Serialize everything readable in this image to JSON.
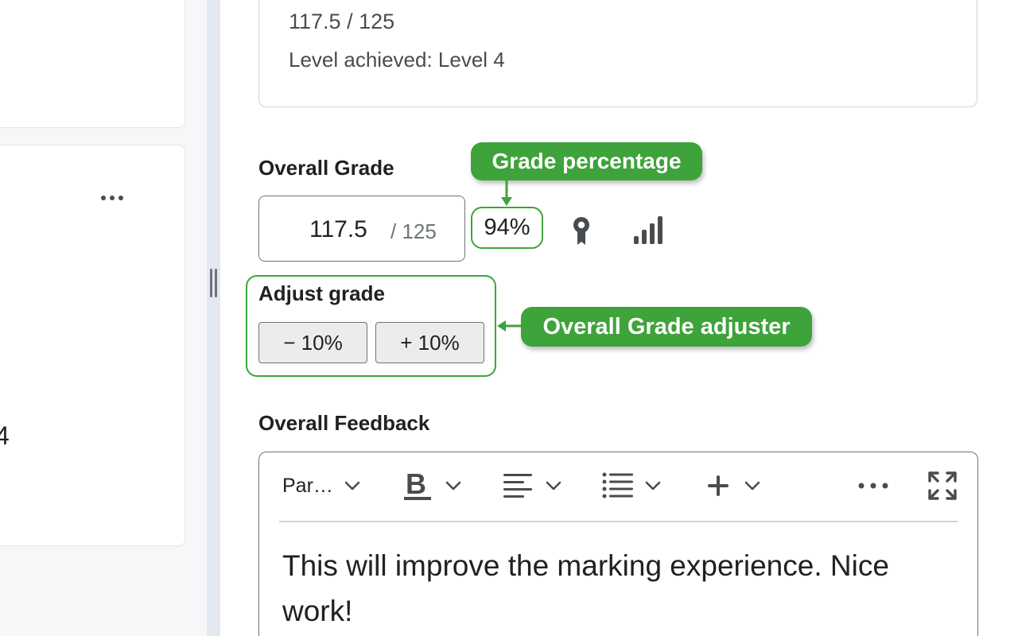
{
  "rubric": {
    "score": "117.5 / 125",
    "level_text": "Level achieved: Level 4"
  },
  "left_pane": {
    "partial_text": "4"
  },
  "grade": {
    "label": "Overall Grade",
    "value": "117.5",
    "out_of": "/ 125",
    "percentage": "94%"
  },
  "adjust": {
    "label": "Adjust grade",
    "minus_label": "− 10%",
    "plus_label": "+ 10%"
  },
  "callouts": {
    "percentage": "Grade percentage",
    "adjuster": "Overall Grade adjuster"
  },
  "feedback": {
    "label": "Overall Feedback",
    "format_label": "Par…",
    "text": "This will improve the marking experience. Nice work!"
  },
  "colors": {
    "accent_green": "#3ea33a",
    "icon_gray": "#494c4e"
  }
}
